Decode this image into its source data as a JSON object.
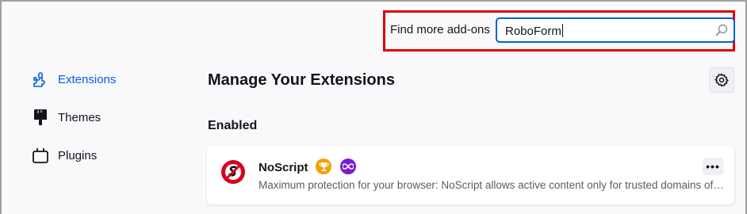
{
  "header": {
    "find_label": "Find more add-ons",
    "search_value": "RoboForm"
  },
  "sidebar": {
    "items": [
      {
        "label": "Extensions",
        "icon": "puzzle-icon",
        "active": true
      },
      {
        "label": "Themes",
        "icon": "brush-icon",
        "active": false
      },
      {
        "label": "Plugins",
        "icon": "plugin-icon",
        "active": false
      }
    ]
  },
  "main": {
    "title": "Manage Your Extensions",
    "section_title": "Enabled",
    "extensions": [
      {
        "name": "NoScript",
        "description": "Maximum protection for your browser: NoScript allows active content only for trusted domains of your choice",
        "badges": [
          "recommended-icon",
          "line-extension-icon"
        ],
        "more_label": "•••"
      }
    ]
  },
  "colors": {
    "accent": "#0061e0",
    "highlight": "#e00000",
    "recommended": "#f59f00",
    "line": "#7d1bd6"
  }
}
